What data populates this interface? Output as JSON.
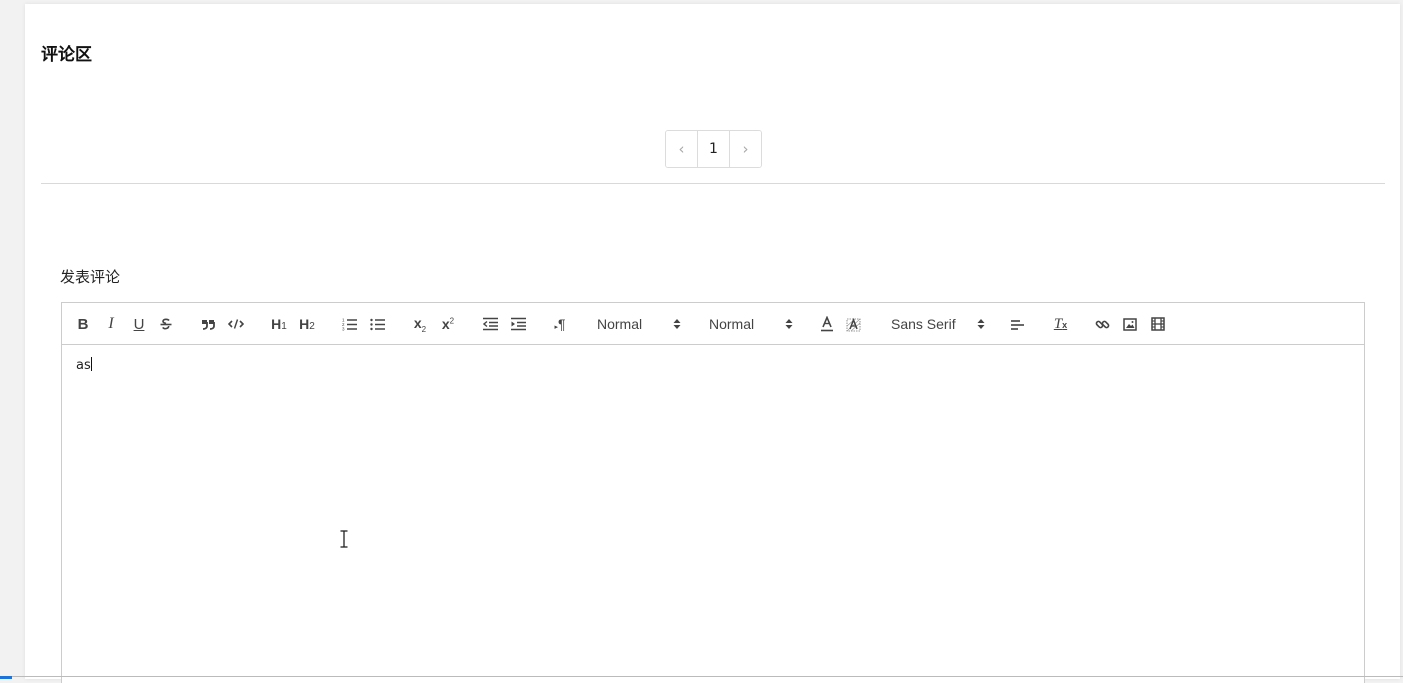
{
  "comments": {
    "title": "评论区",
    "pagination": {
      "prev": "‹",
      "current": "1",
      "next": "›"
    }
  },
  "post": {
    "label": "发表评论",
    "content": "as"
  },
  "toolbar": {
    "bold": "B",
    "italic": "I",
    "underline": "U",
    "header1": "H",
    "header1_sub": "1",
    "header2": "H",
    "header2_sub": "2",
    "sub": "x",
    "sub_mark": "2",
    "sup": "x",
    "sup_mark": "2",
    "direction": "¶",
    "size_picker": "Normal",
    "header_picker": "Normal",
    "font_picker": "Sans Serif",
    "clean": "T"
  },
  "colors": {
    "border": "#cccccc",
    "icon": "#444444",
    "text": "#222222"
  }
}
